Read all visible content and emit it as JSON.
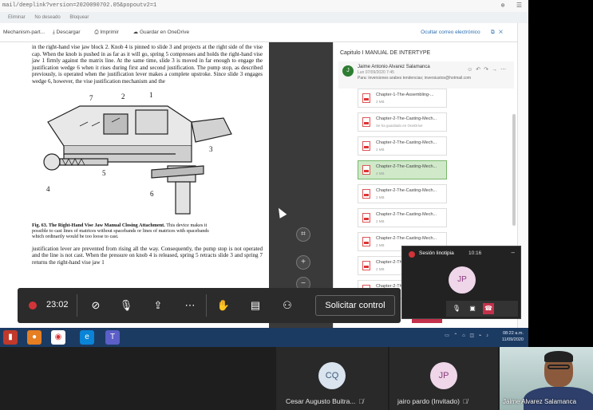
{
  "browser": {
    "url": "mail/deeplink?version=2020090702.05&popoutv2=1",
    "tabs": [
      "Eliminar",
      "No deseado",
      "Bloquear"
    ]
  },
  "toolbar": {
    "attachment": "Mechanism-part...",
    "download": "Descargar",
    "print": "Imprimir",
    "save_onedrive": "Guardar en OneDrive",
    "hide_email": "Ocultar correo electrónico"
  },
  "document": {
    "para1": "in the right-hand vise jaw block 2. Knob 4 is pinned to slide 3 and projects at the right side of the vise cap. When the knob is pushed in as far as it will go, spring 5 compresses and holds the right-hand vise jaw 1 firmly against the matrix line. At the same time, slide 3 is moved in far enough to engage the justification wedge 6 when it rises during first and second justification. The pump stop, as described previously, is operated when the justification lever makes a complete upstroke. Since slide 3 engages wedge 6, however, the vise justification mechanism and the",
    "fig_labels": [
      "7",
      "2",
      "1",
      "3",
      "5",
      "4",
      "6"
    ],
    "caption_bold": "Fig. 63. The Right-Hand Vise Jaw Manual Closing Attachment.",
    "caption": "This device makes it possible to cast lines of matrices without spacebands or lines of matrices with spacebands which ordinarily would be too loose to cast.",
    "para2": "justification lever are prevented from rising all the way. Consequently, the pump stop is not operated and the line is not cast. When the pressure on knob 4 is released, spring 5 retracts slide 3 and spring 7 returns the right-hand vise jaw 1"
  },
  "mail": {
    "subject": "Capitulo I MANUAL DE INTERTYPE",
    "sender_initial": "J",
    "sender_name": "Jaime Antonio Alvarez Salamanca",
    "date": "Lun 07/09/2020 7:45",
    "to": "Para: inversiones arabes tendencias; inversiustos@hotmail.com",
    "attachments": [
      {
        "name": "Chapter-1-The-Assembling-...",
        "size": "2 MB"
      },
      {
        "name": "Chapter-2-The-Casting-Mech...",
        "size": "Se ha guardado en OneDrive"
      },
      {
        "name": "Chapter-2-The-Casting-Mech...",
        "size": "2 MB"
      },
      {
        "name": "Chapter-2-The-Casting-Mech...",
        "size": "2 MB"
      },
      {
        "name": "Chapter-2-The-Casting-Mech...",
        "size": "2 MB"
      },
      {
        "name": "Chapter-2-The-Casting-Mech...",
        "size": "2 MB"
      },
      {
        "name": "Chapter-2-The-Casting-Mech...",
        "size": "2 MB"
      },
      {
        "name": "Chapter-2-The-Casting-Mech...",
        "size": "2 MB"
      },
      {
        "name": "Chapter-2-The-...",
        "size": "2 MB"
      }
    ],
    "selected_index": 3
  },
  "meeting": {
    "timer": "23:02",
    "request_control": "Solicitar control",
    "mini_title": "Sesión linotipia",
    "mini_time": "10:16",
    "mini_avatar": "JP"
  },
  "taskbar": {
    "time": "08:22 a.m.",
    "date": "11/09/2020"
  },
  "participants": [
    {
      "initials": "CQ",
      "name": "Cesar Augusto Buitra..."
    },
    {
      "initials": "JP",
      "name": "jairo pardo (Invitado)"
    },
    {
      "name": "Jaime Alvarez Salamanca"
    }
  ]
}
